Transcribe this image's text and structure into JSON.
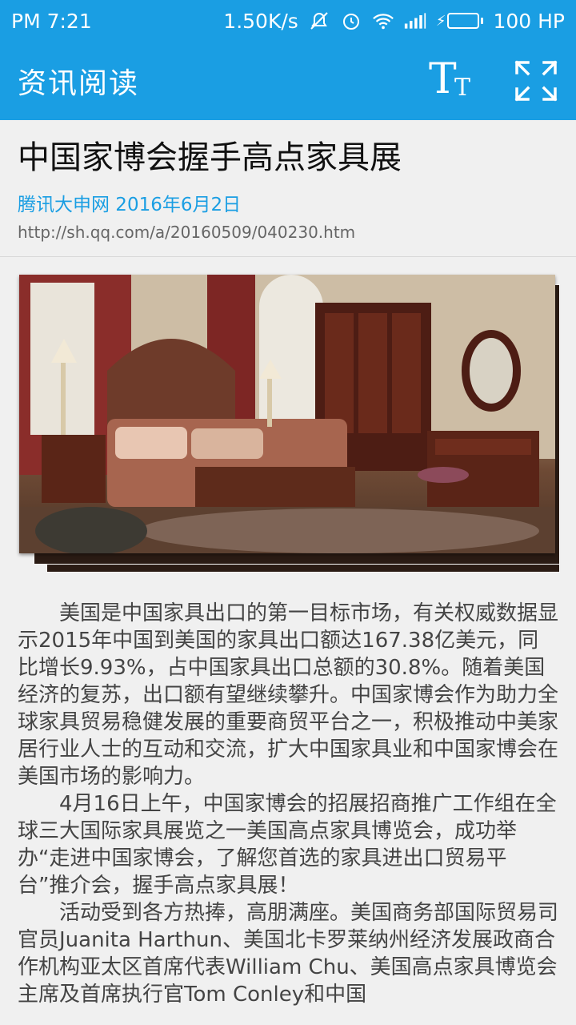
{
  "status_bar": {
    "time": "PM 7:21",
    "speed": "1.50K/s",
    "battery": "100 HP"
  },
  "app_bar": {
    "title": "资讯阅读",
    "font_size_icon": "font-size-icon",
    "fullscreen_icon": "fullscreen-icon"
  },
  "article": {
    "headline": "中国家博会握手高点家具展",
    "source_date": "腾讯大申网 2016年6月2日",
    "url": "http://sh.qq.com/a/20160509/040230.htm",
    "paragraphs": [
      "美国是中国家具出口的第一目标市场，有关权威数据显示2015年中国到美国的家具出口额达167.38亿美元，同比增长9.93%，占中国家具出口总额的30.8%。随着美国经济的复苏，出口额有望继续攀升。中国家博会作为助力全球家具贸易稳健发展的重要商贸平台之一，积极推动中美家居行业人士的互动和交流，扩大中国家具业和中国家博会在美国市场的影响力。",
      "4月16日上午，中国家博会的招展招商推广工作组在全球三大国际家具展览之一美国高点家具博览会，成功举办“走进中国家博会，了解您首选的家具进出口贸易平台”推介会，握手高点家具展！",
      "活动受到各方热捧，高朋满座。美国商务部国际贸易司官员Juanita Harthun、美国北卡罗莱纳州经济发展政商合作机构亚太区首席代表William Chu、美国高点家具博览会主席及首席执行官Tom Conley和中国"
    ]
  },
  "colors": {
    "accent": "#1a9ee3",
    "background": "#f0f0f0"
  }
}
